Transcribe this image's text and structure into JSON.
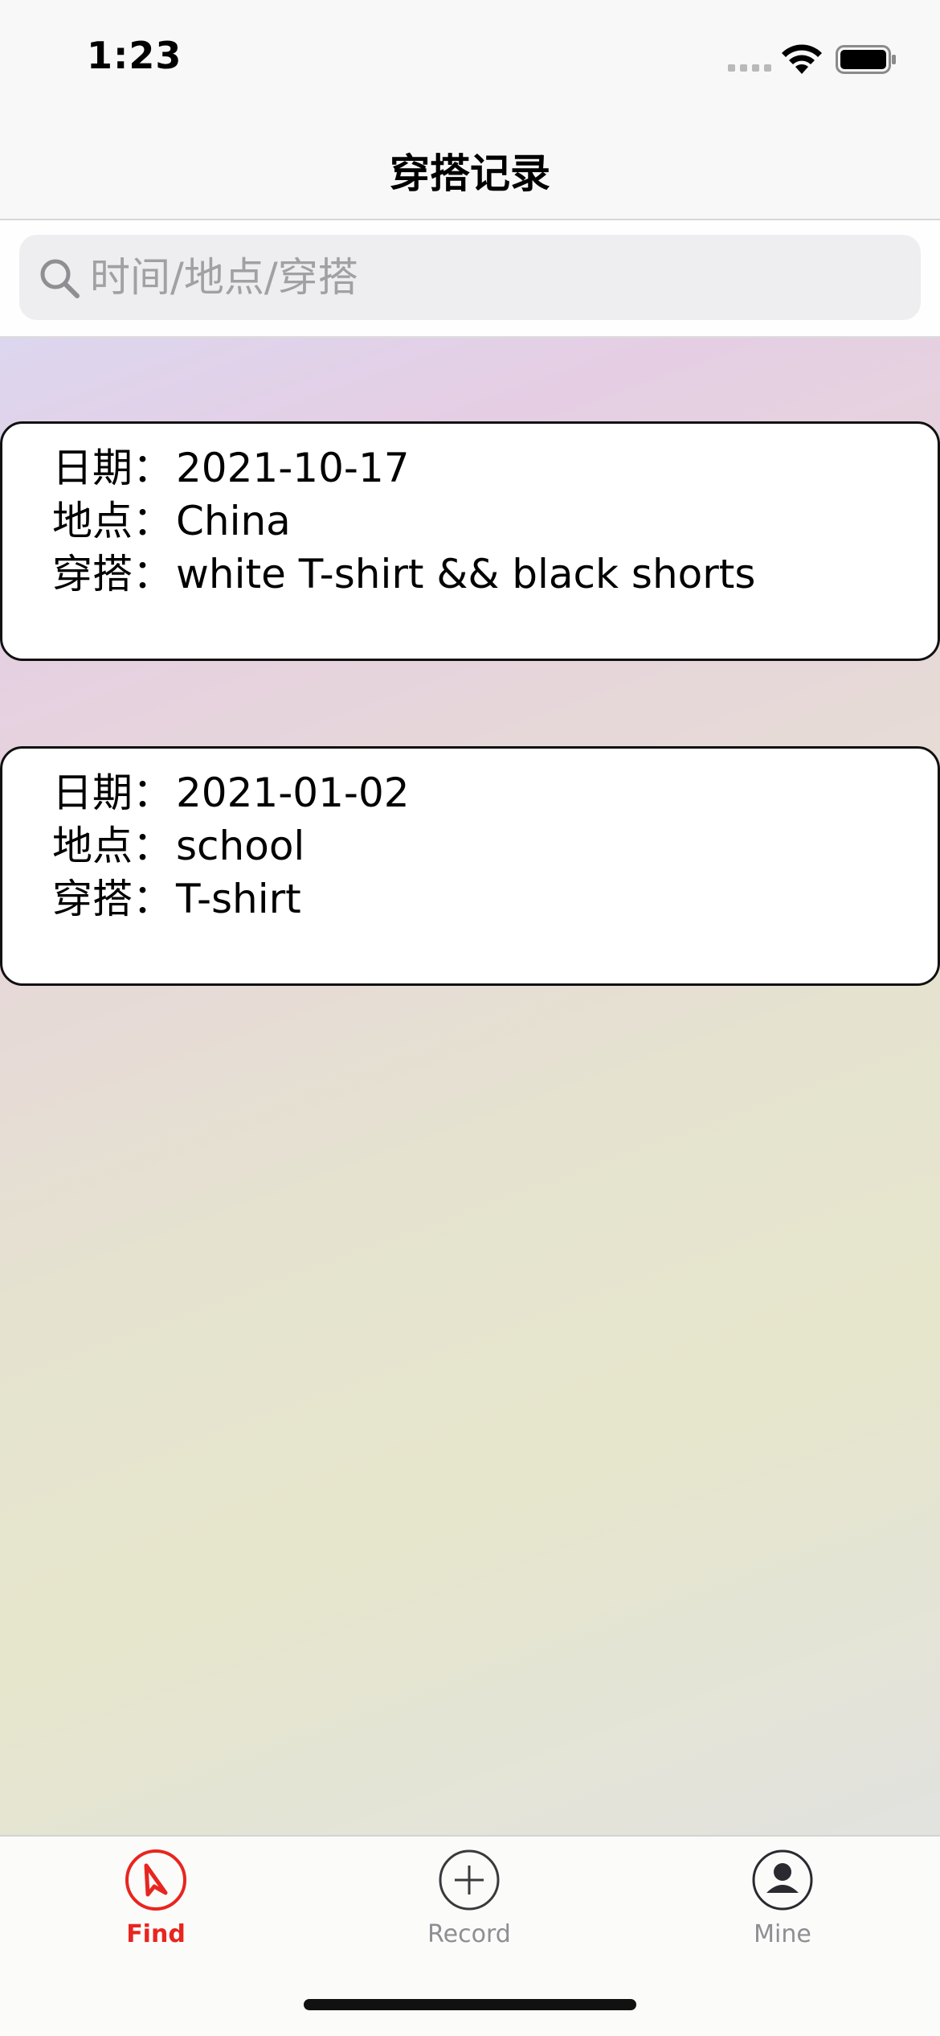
{
  "status_bar": {
    "time": "1:23"
  },
  "nav": {
    "title": "穿搭记录"
  },
  "search": {
    "placeholder": "时间/地点/穿搭",
    "value": ""
  },
  "records": [
    {
      "date_label": "日期：",
      "date": "2021-10-17",
      "place_label": "地点：",
      "place": "China",
      "outfit_label": "穿搭：",
      "outfit": "white T-shirt && black shorts"
    },
    {
      "date_label": "日期：",
      "date": "2021-01-02",
      "place_label": "地点：",
      "place": "school",
      "outfit_label": "穿搭：",
      "outfit": "T-shirt"
    }
  ],
  "tabs": [
    {
      "label": "Find",
      "icon": "compass-icon",
      "active": true
    },
    {
      "label": "Record",
      "icon": "plus-circle-icon",
      "active": false
    },
    {
      "label": "Mine",
      "icon": "person-circle-icon",
      "active": false
    }
  ],
  "colors": {
    "accent": "#e8251f",
    "inactive": "#8e8e93"
  }
}
